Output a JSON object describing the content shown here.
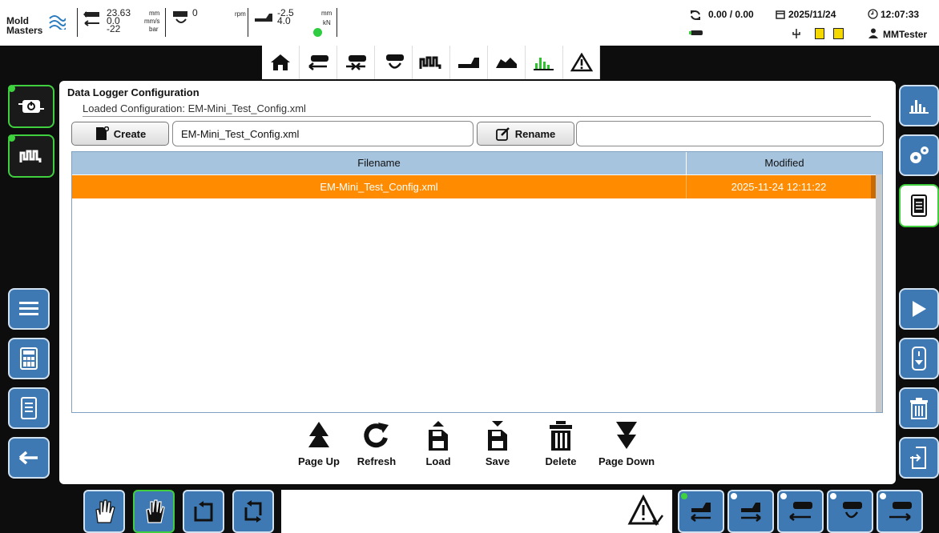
{
  "header": {
    "logo_line1": "Mold",
    "logo_line2": "Masters",
    "gauge1": {
      "v1": "23.63",
      "v2": "0.0",
      "v3": "-22",
      "u1": "mm",
      "u2": "mm/s",
      "u3": "bar"
    },
    "gauge2": {
      "v1": "0",
      "u1": "rpm"
    },
    "gauge3": {
      "v1": "-2.5",
      "v2": "4.0",
      "u1": "mm",
      "u2": "kN"
    },
    "status_ok_color": "#2ecc40",
    "cycle_values": "0.00 / 0.00",
    "date": "2025/11/24",
    "time": "12:07:33",
    "user": "MMTester"
  },
  "nav_icons": [
    "home-icon",
    "inject-back-icon",
    "inject-hold-icon",
    "screw-rotate-icon",
    "heater-icon",
    "carriage-icon",
    "profile-icon",
    "datalogger-icon",
    "alarm-icon"
  ],
  "panel": {
    "title": "Data Logger Configuration",
    "loaded_label": "Loaded Configuration:",
    "loaded_value": "EM-Mini_Test_Config.xml",
    "create_label": "Create",
    "name_value": "EM-Mini_Test_Config.xml",
    "rename_label": "Rename",
    "rename_value": ""
  },
  "table": {
    "columns": [
      "Filename",
      "Modified"
    ],
    "rows": [
      {
        "filename": "EM-Mini_Test_Config.xml",
        "modified": "2025-11-24 12:11:22"
      }
    ]
  },
  "actions": {
    "page_up": "Page Up",
    "refresh": "Refresh",
    "load": "Load",
    "save": "Save",
    "delete": "Delete",
    "page_down": "Page Down"
  },
  "colors": {
    "accent_blue": "#3f79b4",
    "selection": "#ff8c00",
    "active_green": "#3fcf3f",
    "header_blue": "#a7c4de"
  }
}
